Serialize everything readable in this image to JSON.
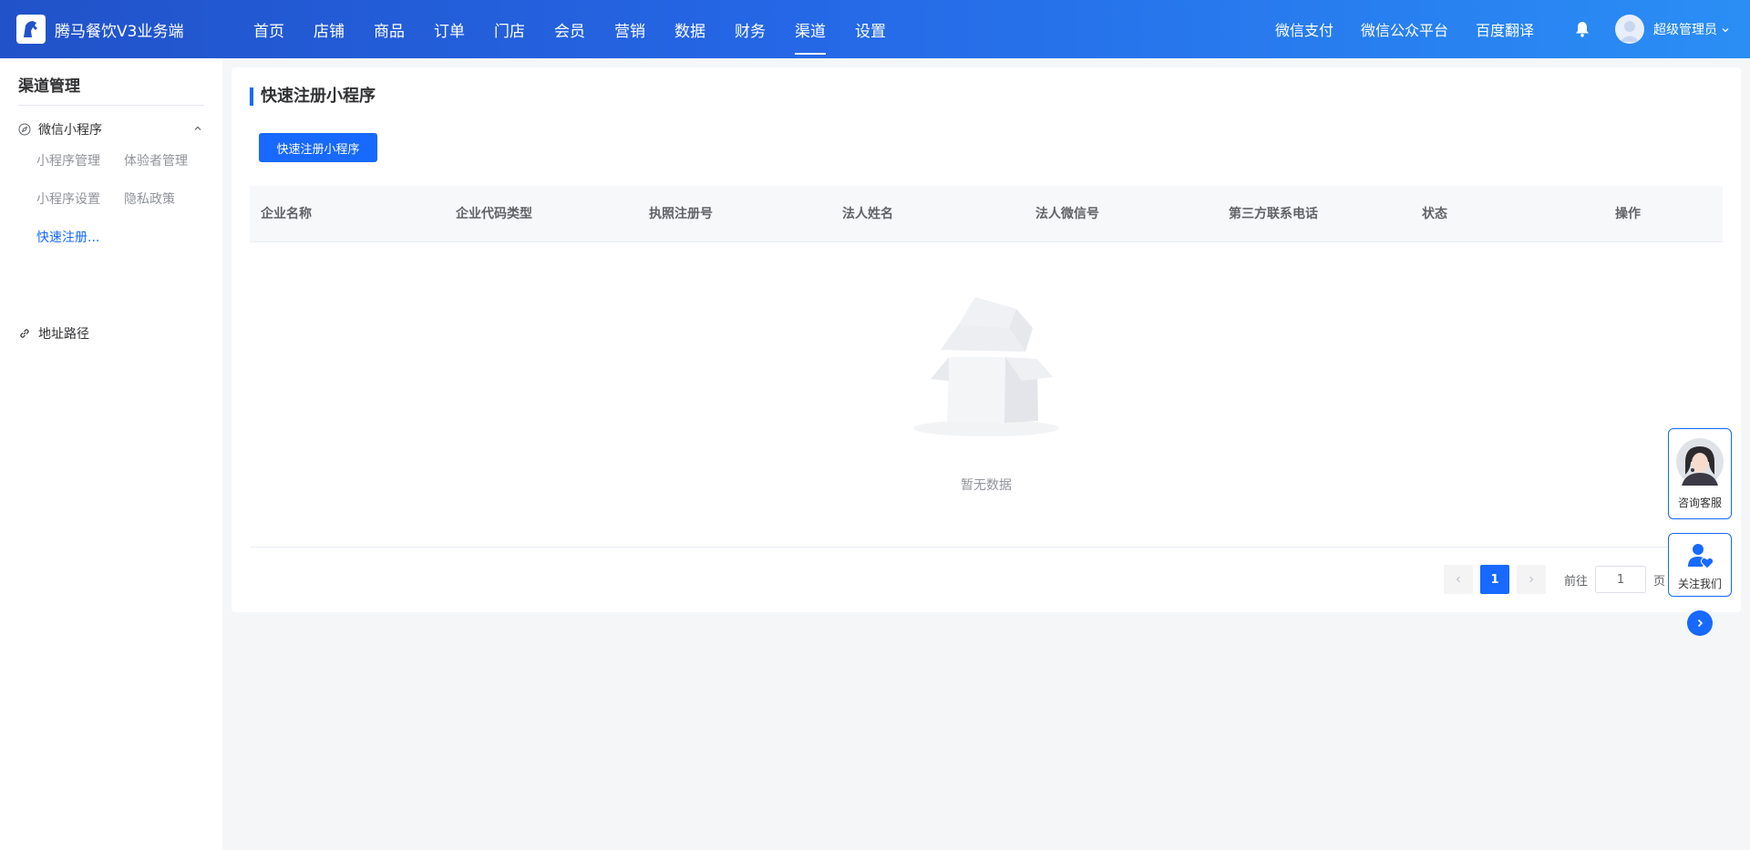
{
  "header": {
    "app_title": "腾马餐饮V3业务端",
    "nav": [
      {
        "label": "首页"
      },
      {
        "label": "店铺"
      },
      {
        "label": "商品"
      },
      {
        "label": "订单"
      },
      {
        "label": "门店"
      },
      {
        "label": "会员"
      },
      {
        "label": "营销"
      },
      {
        "label": "数据"
      },
      {
        "label": "财务"
      },
      {
        "label": "渠道",
        "active": true
      },
      {
        "label": "设置"
      }
    ],
    "links": [
      "微信支付",
      "微信公众平台",
      "百度翻译"
    ],
    "user_name": "超级管理员"
  },
  "sidebar": {
    "title": "渠道管理",
    "group1": {
      "label": "微信小程序",
      "items": [
        "小程序管理",
        "体验者管理",
        "小程序设置",
        "隐私政策",
        "快速注册..."
      ]
    },
    "group2": {
      "label": "地址路径"
    }
  },
  "main": {
    "title": "快速注册小程序",
    "button_label": "快速注册小程序",
    "columns": [
      "企业名称",
      "企业代码类型",
      "执照注册号",
      "法人姓名",
      "法人微信号",
      "第三方联系电话",
      "状态",
      "操作"
    ],
    "empty_text": "暂无数据",
    "pagination": {
      "current_page": "1",
      "goto_label": "前往",
      "goto_value": "1",
      "page_suffix": "页"
    }
  },
  "floating": {
    "service_label": "咨询客服",
    "follow_label": "关注我们"
  },
  "colors": {
    "primary": "#1769ff",
    "header_start": "#2152c9",
    "header_end": "#2a8ef5"
  }
}
